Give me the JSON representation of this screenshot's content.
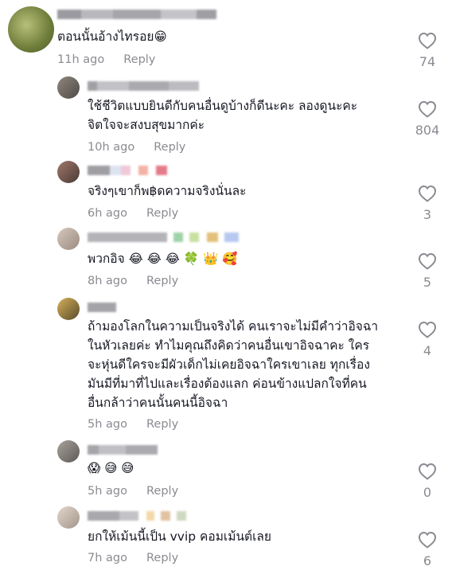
{
  "comments": [
    {
      "text_lines": [
        "ตอนนั้นอ้างไทรอย😁"
      ],
      "time": "11h ago",
      "reply": "Reply",
      "likes": "74",
      "avatar_color": "#8a9a4d"
    },
    {
      "text_lines": [
        "ใช้ชีวิตแบบยินดีกับคนอื่นดูบ้างก็ดีนะคะ ลองดูนะคะ",
        "จิตใจจะสงบสุขมากค่ะ"
      ],
      "time": "10h ago",
      "reply": "Reply",
      "likes": "804",
      "avatar_color": "#6b6560"
    },
    {
      "text_lines": [
        "จริงๆเขาก็พ฿ดความจริงนั่นละ"
      ],
      "time": "6h ago",
      "reply": "Reply",
      "likes": "3",
      "avatar_color": "#7a5a50"
    },
    {
      "text_lines": [
        "พวกอิจ 😂 😂 😂 🍀 👑 🥰"
      ],
      "time": "8h ago",
      "reply": "Reply",
      "likes": "5",
      "avatar_color": "#b7a79a"
    },
    {
      "text_lines": [
        "ถ้ามองโลกในความเป็นจริงได้ คนเราจะไม่มีคำว่าอิจฉา",
        "ในหัวเลยค่ะ ทำไมคุณถึงคิดว่าคนอื่นเขาอิจฉาคะ ใคร",
        "จะหุ่นดีใครจะมีผัวเด็กไม่เคยอิจฉาใครเขาเลย ทุกเรื่อง",
        "มันมีที่มาที่ไปและเรื่องต้องแลก ค่อนข้างแปลกใจที่คน",
        "อื่นกล้าว่าคนนั้นคนนี้อิจฉา"
      ],
      "time": "5h ago",
      "reply": "Reply",
      "likes": "4",
      "avatar_color": "#a28a50"
    },
    {
      "text_lines": [
        "😱 😅 😅"
      ],
      "time": "5h ago",
      "reply": "Reply",
      "likes": "0",
      "avatar_color": "#8a8580"
    },
    {
      "text_lines": [
        "ยกให้เม้นนี้เป็น vvip คอมเม้นต์เลย"
      ],
      "time": "7h ago",
      "reply": "Reply",
      "likes": "6",
      "avatar_color": "#c2b4aa"
    }
  ]
}
